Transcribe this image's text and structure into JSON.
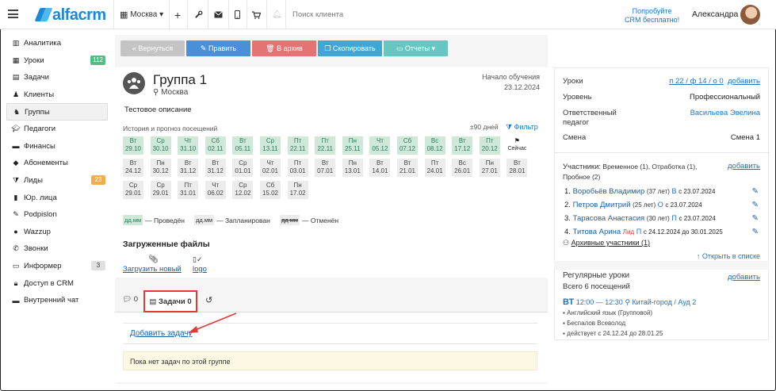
{
  "topbar": {
    "logo": "alfacrm",
    "city": "Москва",
    "search_placeholder": "Поиск клиента",
    "promo_line1": "Попробуйте",
    "promo_line2": "CRM бесплатно!",
    "user_name": "Александра"
  },
  "sidebar": {
    "items": [
      {
        "label": "Аналитика",
        "icon": "chart-icon"
      },
      {
        "label": "Уроки",
        "icon": "calendar-icon",
        "badge": "112"
      },
      {
        "label": "Задачи",
        "icon": "tasks-icon"
      },
      {
        "label": "Клиенты",
        "icon": "user-icon"
      },
      {
        "label": "Группы",
        "icon": "group-icon"
      },
      {
        "label": "Педагоги",
        "icon": "teacher-icon"
      },
      {
        "label": "Финансы",
        "icon": "money-icon"
      },
      {
        "label": "Абонементы",
        "icon": "tag-icon"
      },
      {
        "label": "Лиды",
        "icon": "funnel-icon",
        "badge": "23"
      },
      {
        "label": "Юр. лица",
        "icon": "building-icon"
      },
      {
        "label": "Podpislon",
        "icon": "pen-icon"
      },
      {
        "label": "Wazzup",
        "icon": "whatsapp-icon"
      },
      {
        "label": "Звонки",
        "icon": "phone-icon"
      },
      {
        "label": "Информер",
        "icon": "chat-icon",
        "badge": "3"
      },
      {
        "label": "Доступ в CRM",
        "icon": "lock-icon"
      },
      {
        "label": "Внутренний чат",
        "icon": "message-icon"
      }
    ],
    "colors": {
      "badge_green": "#5cb885",
      "badge_orange": "#f0ad4e",
      "badge_gray": "#e0e0e0"
    }
  },
  "actions": {
    "back": "« Вернуться",
    "edit": "✎ Править",
    "archive": "🗑 В архив",
    "copy": "❐ Скопировать",
    "reports": "▭ Отчеты ▾"
  },
  "group": {
    "title": "Группа 1",
    "city": "Москва",
    "start_label": "Начало обучения",
    "start_date": "23.12.2024",
    "description": "Тестовое описание",
    "history_label": "История и прогноз посещений",
    "days_label": "±90 дней",
    "filter_label": "Фильтр",
    "attendance": [
      {
        "d": "Вт",
        "date": "29.10",
        "s": "done"
      },
      {
        "d": "Ср",
        "date": "30.10",
        "s": "done"
      },
      {
        "d": "Чт",
        "date": "31.10",
        "s": "done"
      },
      {
        "d": "Сб",
        "date": "02.11",
        "s": "done"
      },
      {
        "d": "Вт",
        "date": "05.11",
        "s": "done"
      },
      {
        "d": "Ср",
        "date": "13.11",
        "s": "done"
      },
      {
        "d": "Пт",
        "date": "22.11",
        "s": "done"
      },
      {
        "d": "Пт",
        "date": "22.11",
        "s": "done"
      },
      {
        "d": "Пн",
        "date": "25.11",
        "s": "done"
      },
      {
        "d": "Чт",
        "date": "05.12",
        "s": "done"
      },
      {
        "d": "Сб",
        "date": "07.12",
        "s": "done"
      },
      {
        "d": "Вс",
        "date": "08.12",
        "s": "done"
      },
      {
        "d": "Вт",
        "date": "17.12",
        "s": "done"
      },
      {
        "d": "Пт",
        "date": "20.12",
        "s": "done"
      },
      {
        "d": "⚑",
        "date": "Сейчас",
        "s": "now"
      },
      {
        "d": "Вт",
        "date": "24.12",
        "s": "plan"
      },
      {
        "d": "Пн",
        "date": "30.12",
        "s": "plan"
      },
      {
        "d": "Вт",
        "date": "31.12",
        "s": "plan"
      },
      {
        "d": "Вт",
        "date": "31.12",
        "s": "plan"
      },
      {
        "d": "Ср",
        "date": "01.01",
        "s": "plan"
      },
      {
        "d": "Чт",
        "date": "02.01",
        "s": "plan"
      },
      {
        "d": "Пт",
        "date": "03.01",
        "s": "plan"
      },
      {
        "d": "Вт",
        "date": "07.01",
        "s": "plan"
      },
      {
        "d": "Пн",
        "date": "13.01",
        "s": "plan"
      },
      {
        "d": "Вт",
        "date": "14.01",
        "s": "plan"
      },
      {
        "d": "Вт",
        "date": "21.01",
        "s": "plan"
      },
      {
        "d": "Пт",
        "date": "24.01",
        "s": "plan"
      },
      {
        "d": "Вс",
        "date": "26.01",
        "s": "plan"
      },
      {
        "d": "Пн",
        "date": "27.01",
        "s": "plan"
      },
      {
        "d": "Вт",
        "date": "28.01",
        "s": "plan"
      },
      {
        "d": "Ср",
        "date": "29.01",
        "s": "plan"
      },
      {
        "d": "Ср",
        "date": "29.01",
        "s": "plan"
      },
      {
        "d": "Пт",
        "date": "31.01",
        "s": "plan"
      },
      {
        "d": "Чт",
        "date": "06.02",
        "s": "plan"
      },
      {
        "d": "Ср",
        "date": "12.02",
        "s": "plan"
      },
      {
        "d": "Сб",
        "date": "15.02",
        "s": "plan"
      },
      {
        "d": "Пн",
        "date": "17.02",
        "s": "plan"
      }
    ],
    "legend_sample": "дд.мм",
    "legend_done": "— Проведён",
    "legend_planned": "— Запланирован",
    "legend_cancelled": "— Отменён",
    "files_title": "Загруженные файлы",
    "upload_label": "Загрузить новый",
    "logo_file": "logo"
  },
  "tabs": {
    "comments": "0",
    "tasks": "Задачи 0"
  },
  "tasks": {
    "add_label": "Добавить задачу",
    "empty_label": "Пока нет задач по этой группе"
  },
  "right": {
    "lessons_label": "Уроки",
    "lessons_value": "п 22 / ф 14 / о 0",
    "lessons_add": "добавить",
    "level_label": "Уровень",
    "level_value": "Профессиональный",
    "resp_label": "Ответственный педагог",
    "resp_value": "Васильева Эвелина",
    "shift_label": "Смена",
    "shift_value": "Смена 1",
    "members_label": "Участники:",
    "members_sub": "Временное (1), Отработка (1), Пробное (2)",
    "members_add": "добавить",
    "members": [
      {
        "num": "1.",
        "name": "Воробьёв Владимир",
        "age": "(37 лет)",
        "tag": "В",
        "since": "с 23.07.2024"
      },
      {
        "num": "2.",
        "name": "Петров Дмитрий",
        "age": "(25 лет)",
        "tag": "О",
        "since": "с 23.07.2024"
      },
      {
        "num": "3.",
        "name": "Тарасова Анастасия",
        "age": "(30 лет)",
        "tag": "П",
        "since": "с 23.07.2024"
      },
      {
        "num": "4.",
        "name": "Титова Арина",
        "age": "Лид",
        "tag": "П",
        "since": "с 24.12.2024 до 30.01.2025"
      }
    ],
    "archive_members": "Архивные участники (1)",
    "open_list": "Открыть в списке",
    "regular_title": "Регулярные уроки",
    "regular_add": "добавить",
    "regular_total": "Всего 6 посещений",
    "regular_day": "ВТ",
    "regular_time": "12:00 — 12:30",
    "regular_place": "Китай-город / Ауд 2",
    "regular_subject": "Английский язык (Групповой)",
    "regular_teacher": "Беспалов Всеволод",
    "regular_period": "действует с 24.12.24 до 28.01.25"
  }
}
